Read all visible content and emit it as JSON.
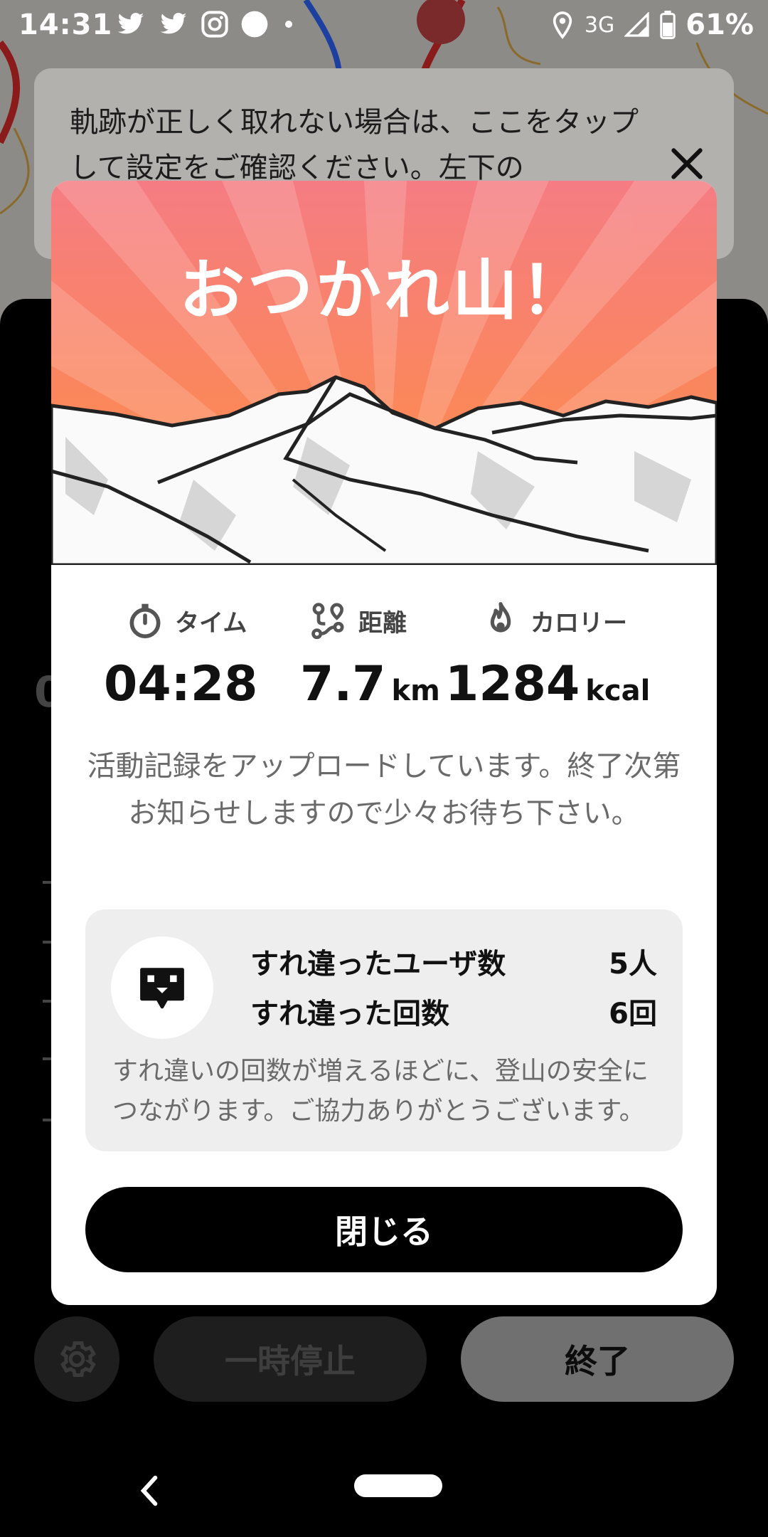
{
  "status_bar": {
    "time": "14:31",
    "icons": [
      "twitter-icon",
      "twitter-icon",
      "instagram-icon",
      "circle-icon",
      "dot-icon"
    ],
    "network": "3G",
    "battery": "61%"
  },
  "banner": {
    "text": "軌跡が正しく取れない場合は、ここをタップして設定をご確認ください。左下の"
  },
  "background": {
    "value_peek": "0"
  },
  "modal": {
    "title": "おつかれ山！",
    "stats": [
      {
        "label": "タイム",
        "value": "04:28",
        "unit": "",
        "icon": "stopwatch-icon"
      },
      {
        "label": "距離",
        "value": "7.7",
        "unit": "km",
        "icon": "route-icon"
      },
      {
        "label": "カロリー",
        "value": "1284",
        "unit": "kcal",
        "icon": "flame-icon"
      }
    ],
    "upload_message": "活動記録をアップロードしています。終了次第お知らせしますので少々お待ち下さい。",
    "passing": {
      "users_label": "すれ違ったユーザ数",
      "users_value": "5人",
      "count_label": "すれ違った回数",
      "count_value": "6回",
      "note": "すれ違いの回数が増えるほどに、登山の安全につながります。ご協力ありがとうございます。"
    },
    "close_label": "閉じる"
  },
  "controls": {
    "pause_label": "一時停止",
    "end_label": "終了"
  },
  "colors": {
    "hero_top": "#f57c83",
    "hero_bottom": "#ff8f3f",
    "button_dark": "#000000"
  }
}
